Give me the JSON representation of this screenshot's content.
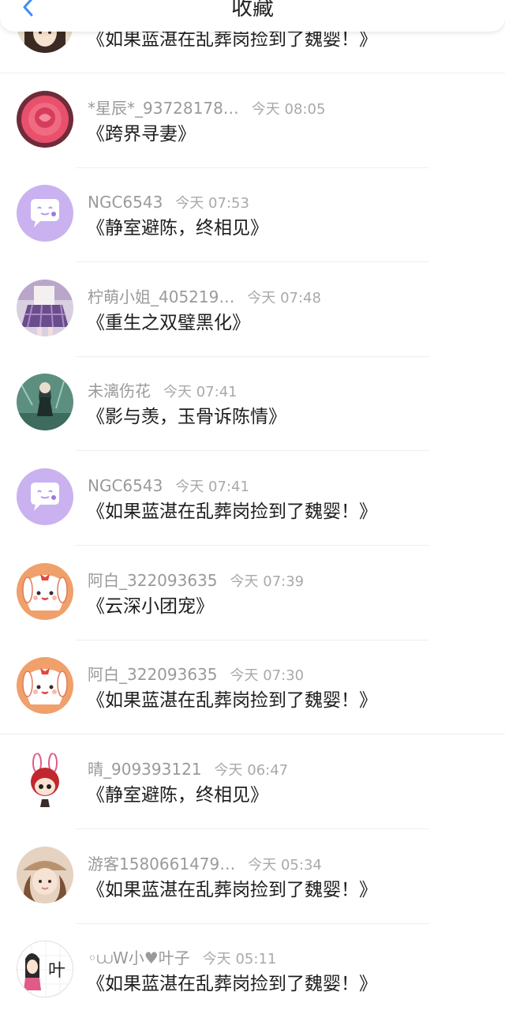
{
  "header": {
    "title": "收藏",
    "back_icon": "chevron-left-icon",
    "accent_color": "#3d8ef5"
  },
  "favorites": [
    {
      "user": "",
      "time": "",
      "title": "《如果蓝湛在乱葬岗捡到了魏婴！》",
      "avatar": "anime-girl-photo"
    },
    {
      "user": "*星辰*_93728178…",
      "time": "今天 08:05",
      "title": "《跨界寻妻》",
      "avatar": "pink-rose-photo"
    },
    {
      "user": "NGC6543",
      "time": "今天 07:53",
      "title": "《静室避陈，终相见》",
      "avatar": "default-chat-bubble"
    },
    {
      "user": "柠萌小姐_405219…",
      "time": "今天 07:48",
      "title": "《重生之双璧黑化》",
      "avatar": "plaid-skirt-photo"
    },
    {
      "user": "未漓伤花",
      "time": "今天 07:41",
      "title": "《影与羡，玉骨诉陈情》",
      "avatar": "teal-sketch-photo"
    },
    {
      "user": "NGC6543",
      "time": "今天 07:41",
      "title": "《如果蓝湛在乱葬岗捡到了魏婴！》",
      "avatar": "default-chat-bubble"
    },
    {
      "user": "阿白_322093635",
      "time": "今天 07:39",
      "title": "《云深小团宠》",
      "avatar": "bunny-cartoon"
    },
    {
      "user": "阿白_322093635",
      "time": "今天 07:30",
      "title": "《如果蓝湛在乱葬岗捡到了魏婴！》",
      "avatar": "bunny-cartoon"
    },
    {
      "user": "晴_909393121",
      "time": "今天 06:47",
      "title": "《静室避陈，终相见》",
      "avatar": "rabbit-hat-cartoon"
    },
    {
      "user": "游客1580661479…",
      "time": "今天 05:34",
      "title": "《如果蓝湛在乱葬岗捡到了魏婴！》",
      "avatar": "girl-hat-photo"
    },
    {
      "user": "◦⩊W小♥叶子",
      "time": "今天 05:11",
      "title": "《如果蓝湛在乱葬岗捡到了魏婴！》",
      "avatar": "ye-character-sticker",
      "avatar_text": "叶"
    }
  ]
}
